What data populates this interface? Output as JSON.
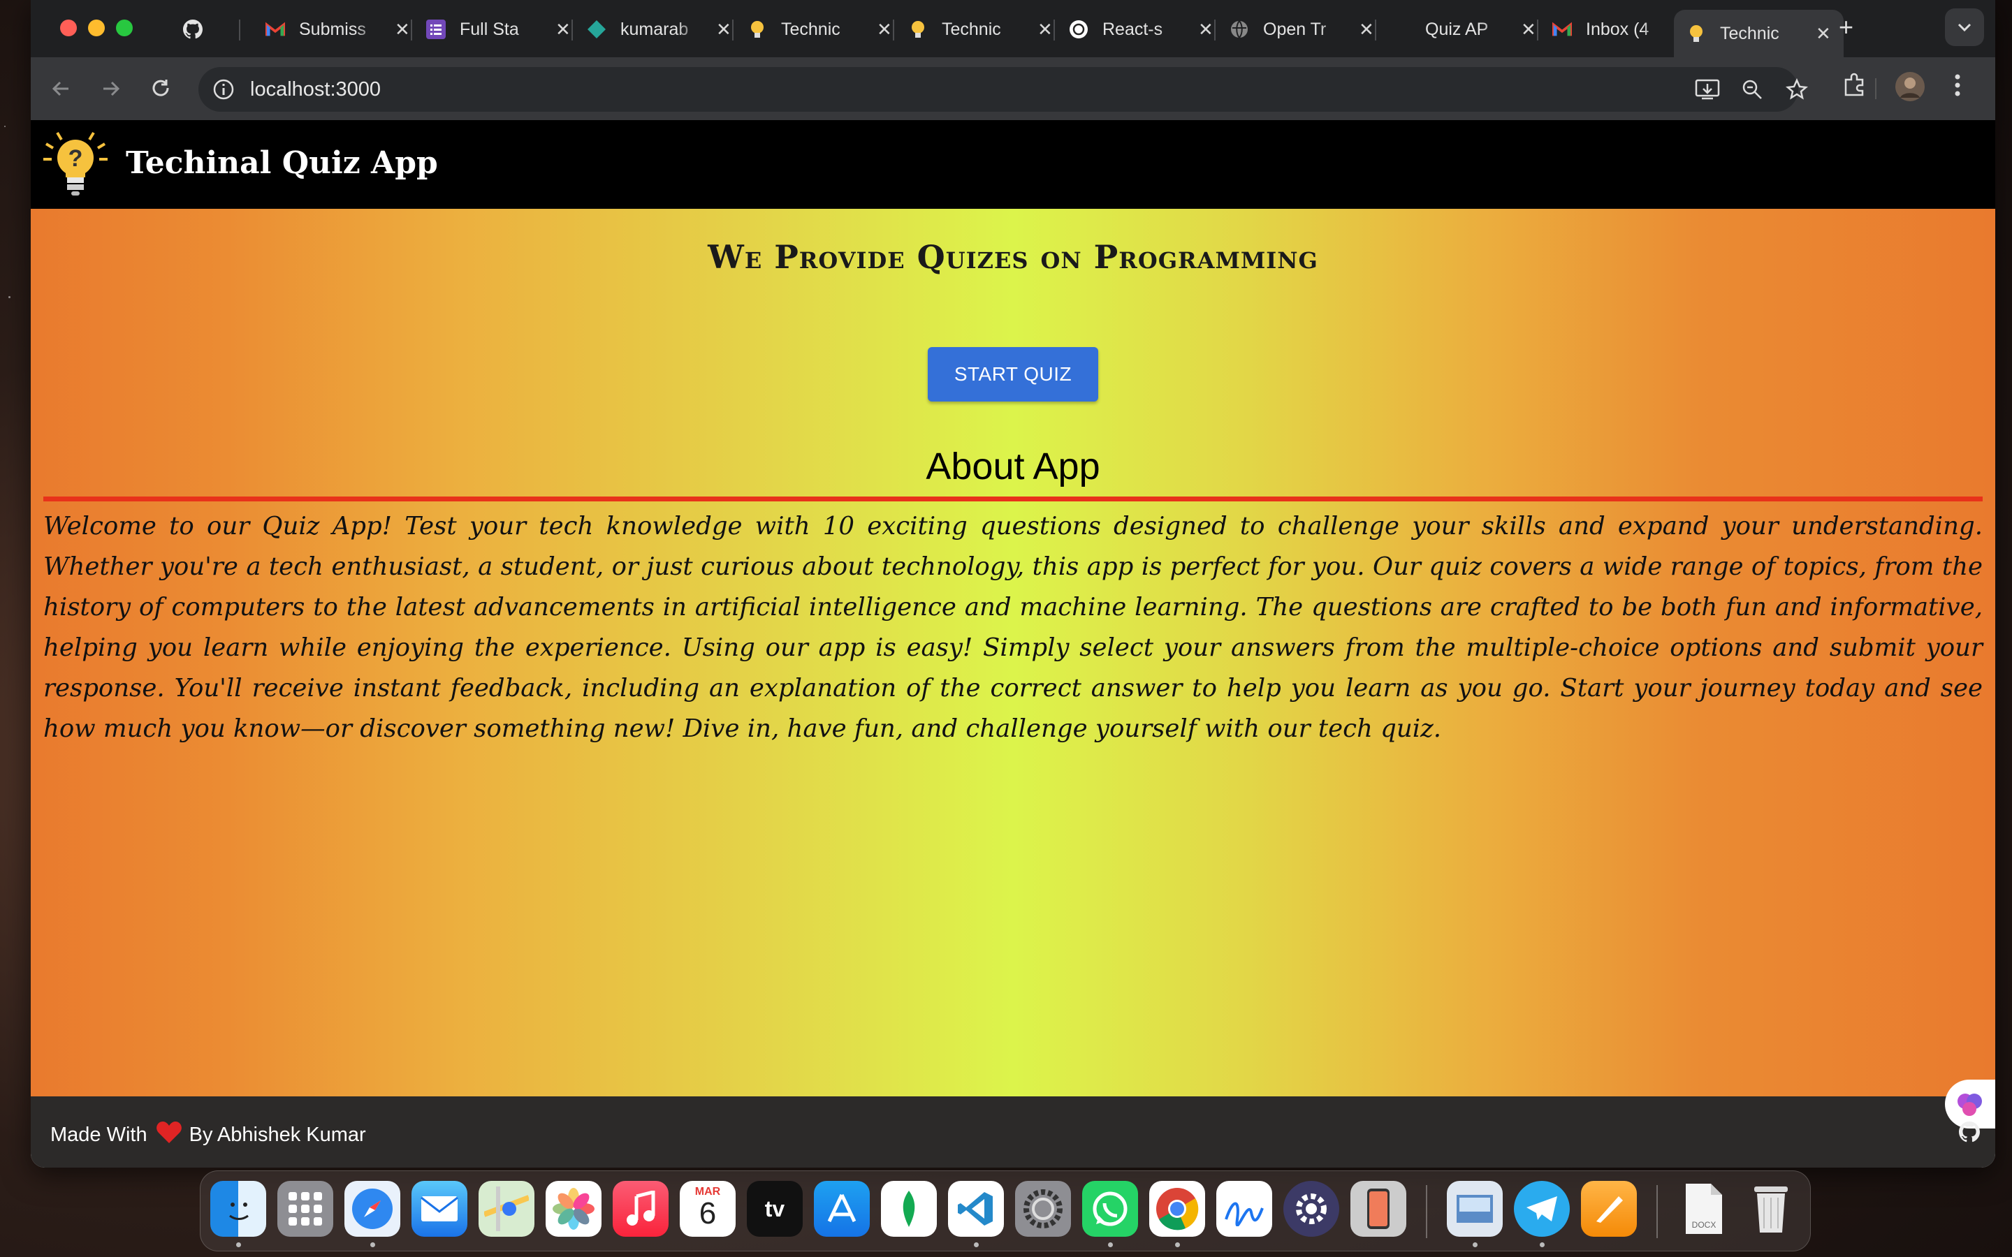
{
  "browser": {
    "tabs": [
      {
        "label": "",
        "icon": "github-icon"
      },
      {
        "label": "Submiss",
        "icon": "gmail-icon"
      },
      {
        "label": "Full Sta",
        "icon": "forms-icon"
      },
      {
        "label": "kumarab",
        "icon": "diamond-icon"
      },
      {
        "label": "Technic",
        "icon": "bulb-icon"
      },
      {
        "label": "Technic",
        "icon": "bulb-icon"
      },
      {
        "label": "React-s",
        "icon": "openai-icon"
      },
      {
        "label": "Open Tr",
        "icon": "globe-icon"
      },
      {
        "label": "Quiz AP",
        "icon": "blank-icon"
      },
      {
        "label": "Inbox (4",
        "icon": "gmail-icon"
      },
      {
        "label": "Technic",
        "icon": "bulb-icon",
        "active": true
      }
    ],
    "close_glyph": "✕",
    "new_tab_glyph": "+",
    "url": "localhost:3000"
  },
  "app": {
    "title": "Techinal Quiz App",
    "headline": "We Provide Quizes on Programming",
    "start_button": "START QUIZ",
    "about_heading": "About App",
    "about_text": "Welcome to our Quiz App! Test your tech knowledge with 10 exciting questions designed to challenge your skills and expand your understanding. Whether you're a tech enthusiast, a student, or just curious about technology, this app is perfect for you. Our quiz covers a wide range of topics, from the history of computers to the latest advancements in artificial intelligence and machine learning. The questions are crafted to be both fun and informative, helping you learn while enjoying the experience. Using our app is easy! Simply select your answers from the multiple-choice options and submit your response. You'll receive instant feedback, including an explanation of the correct answer to help you learn as you go. Start your journey today and see how much you know—or discover something new! Dive in, have fun, and challenge yourself with our tech quiz.",
    "footer_prefix": "Made With",
    "footer_suffix": "By Abhishek Kumar"
  },
  "dock": {
    "apps": [
      "finder",
      "launchpad",
      "safari",
      "mail",
      "maps",
      "photos",
      "music",
      "calendar",
      "tv",
      "app-store",
      "mongodb",
      "vscode",
      "system-settings",
      "whatsapp",
      "chrome",
      "freeform",
      "control-center",
      "iphone-mirroring",
      "preview",
      "telegram",
      "pages",
      "docx-file",
      "trash"
    ],
    "calendar_month": "MAR",
    "calendar_day": "6",
    "tv_label": "tv",
    "docx_label": "DOCX"
  },
  "colors": {
    "accent": "#3470d8",
    "rule": "#e8321a",
    "header_bg": "#000000",
    "footer_bg": "#2c2a29"
  }
}
